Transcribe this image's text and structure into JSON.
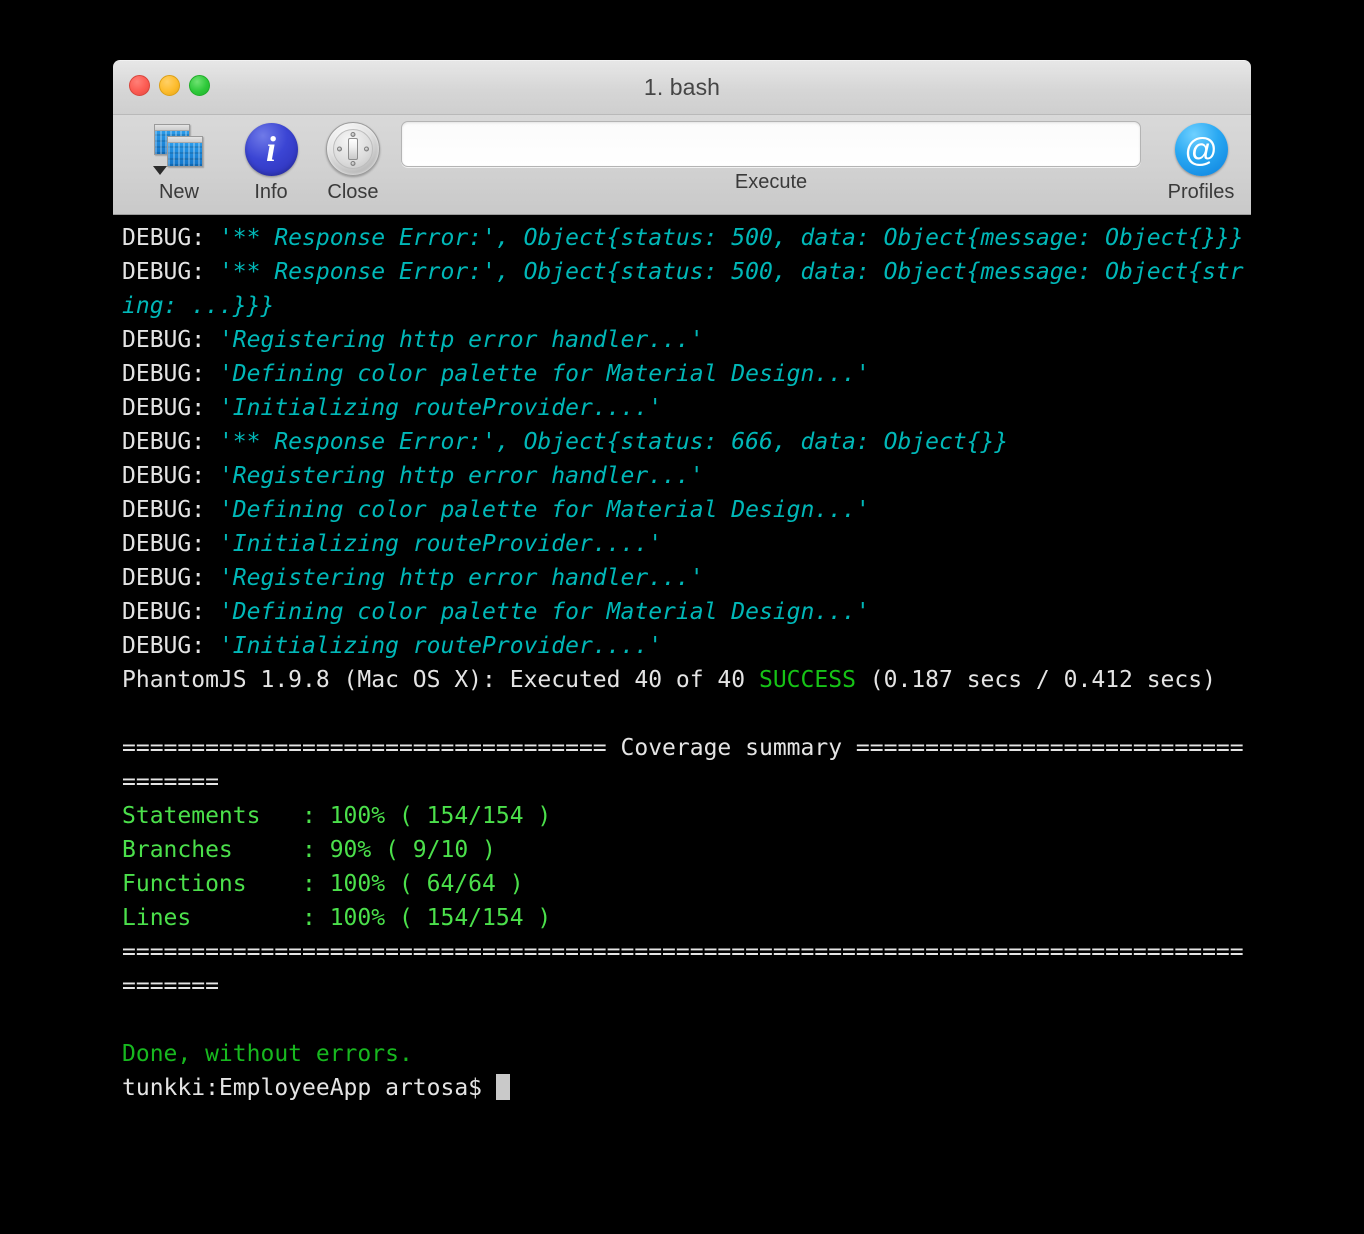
{
  "window": {
    "title": "1. bash",
    "traffic_lights": [
      {
        "name": "close",
        "color": "#fc5b52"
      },
      {
        "name": "minimize",
        "color": "#fdbc2d"
      },
      {
        "name": "zoom",
        "color": "#2ec93a"
      }
    ]
  },
  "toolbar": {
    "new_label": "New",
    "new_icon": "new-window-icon",
    "info_label": "Info",
    "info_icon": "info-circle-icon",
    "info_glyph": "i",
    "close_label": "Close",
    "close_icon": "close-dial-icon",
    "execute_label": "Execute",
    "execute_value": "",
    "execute_placeholder": "",
    "profiles_label": "Profiles",
    "profiles_icon": "at-sign-icon",
    "profiles_glyph": "@"
  },
  "terminal": {
    "colors": {
      "background": "#000000",
      "white": "#e4e4e4",
      "cyan": "#00b8b8",
      "green_bright": "#4be04b",
      "green_mid": "#16c316",
      "green_dark": "#17b81f",
      "cursor": "#c9c9c9"
    },
    "lines": [
      {
        "id": "l1",
        "parts": [
          {
            "text": "DEBUG: ",
            "style": "white"
          },
          {
            "text": "'** Response Error:', Object{status: 500, data: Object{message: Object{}}}",
            "style": "cyan"
          }
        ]
      },
      {
        "id": "l2",
        "parts": [
          {
            "text": "DEBUG: ",
            "style": "white"
          },
          {
            "text": "'** Response Error:', Object{status: 500, data: Object{message: Object{string: ...}}}",
            "style": "cyan"
          }
        ]
      },
      {
        "id": "l3",
        "parts": [
          {
            "text": "DEBUG: ",
            "style": "white"
          },
          {
            "text": "'Registering http error handler...'",
            "style": "cyan"
          }
        ]
      },
      {
        "id": "l4",
        "parts": [
          {
            "text": "DEBUG: ",
            "style": "white"
          },
          {
            "text": "'Defining color palette for Material Design...'",
            "style": "cyan"
          }
        ]
      },
      {
        "id": "l5",
        "parts": [
          {
            "text": "DEBUG: ",
            "style": "white"
          },
          {
            "text": "'Initializing routeProvider....'",
            "style": "cyan"
          }
        ]
      },
      {
        "id": "l6",
        "parts": [
          {
            "text": "DEBUG: ",
            "style": "white"
          },
          {
            "text": "'** Response Error:', Object{status: 666, data: Object{}}",
            "style": "cyan"
          }
        ]
      },
      {
        "id": "l7",
        "parts": [
          {
            "text": "DEBUG: ",
            "style": "white"
          },
          {
            "text": "'Registering http error handler...'",
            "style": "cyan"
          }
        ]
      },
      {
        "id": "l8",
        "parts": [
          {
            "text": "DEBUG: ",
            "style": "white"
          },
          {
            "text": "'Defining color palette for Material Design...'",
            "style": "cyan"
          }
        ]
      },
      {
        "id": "l9",
        "parts": [
          {
            "text": "DEBUG: ",
            "style": "white"
          },
          {
            "text": "'Initializing routeProvider....'",
            "style": "cyan"
          }
        ]
      },
      {
        "id": "l10",
        "parts": [
          {
            "text": "DEBUG: ",
            "style": "white"
          },
          {
            "text": "'Registering http error handler...'",
            "style": "cyan"
          }
        ]
      },
      {
        "id": "l11",
        "parts": [
          {
            "text": "DEBUG: ",
            "style": "white"
          },
          {
            "text": "'Defining color palette for Material Design...'",
            "style": "cyan"
          }
        ]
      },
      {
        "id": "l12",
        "parts": [
          {
            "text": "DEBUG: ",
            "style": "white"
          },
          {
            "text": "'Initializing routeProvider....'",
            "style": "cyan"
          }
        ]
      },
      {
        "id": "l13",
        "parts": [
          {
            "text": "PhantomJS 1.9.8 (Mac OS X): Executed 40 of 40 ",
            "style": "white"
          },
          {
            "text": "SUCCESS",
            "style": "green_mid"
          },
          {
            "text": " (0.187 secs / 0.412 secs)",
            "style": "white"
          }
        ]
      },
      {
        "id": "l14",
        "parts": [
          {
            "text": "",
            "style": "white"
          }
        ]
      },
      {
        "id": "l15",
        "parts": [
          {
            "text": "=================================== Coverage summary ===================================",
            "style": "white"
          }
        ]
      },
      {
        "id": "l16",
        "parts": [
          {
            "text": "Statements   : 100% ( 154/154 )",
            "style": "green_bright"
          }
        ]
      },
      {
        "id": "l17",
        "parts": [
          {
            "text": "Branches     : 90% ( 9/10 )",
            "style": "green_bright"
          }
        ]
      },
      {
        "id": "l18",
        "parts": [
          {
            "text": "Functions    : 100% ( 64/64 )",
            "style": "green_bright"
          }
        ]
      },
      {
        "id": "l19",
        "parts": [
          {
            "text": "Lines        : 100% ( 154/154 )",
            "style": "green_bright"
          }
        ]
      },
      {
        "id": "l20",
        "parts": [
          {
            "text": "========================================================================================",
            "style": "white"
          }
        ]
      },
      {
        "id": "l21",
        "parts": [
          {
            "text": "",
            "style": "white"
          }
        ]
      },
      {
        "id": "l22",
        "parts": [
          {
            "text": "Done, without errors.",
            "style": "green_dark"
          }
        ]
      },
      {
        "id": "l23",
        "parts": [
          {
            "text": "tunkki:EmployeeApp artosa$ ",
            "style": "white"
          },
          {
            "text": "",
            "style": "cursor"
          }
        ]
      }
    ]
  }
}
